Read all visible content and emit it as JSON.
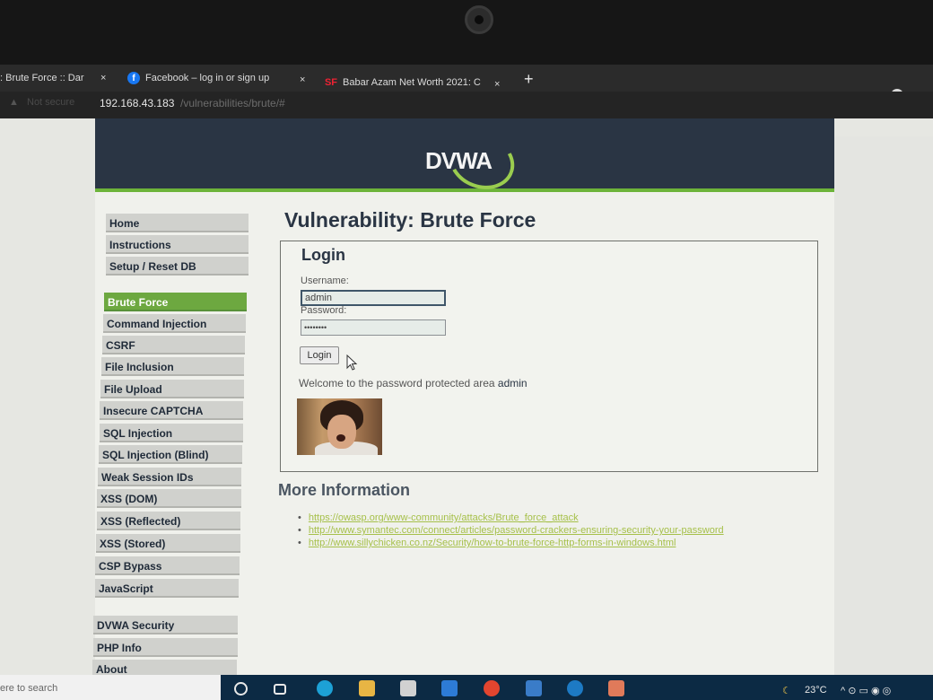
{
  "browser": {
    "tabs": [
      {
        "label": ": Brute Force :: Dar",
        "close": "×"
      },
      {
        "label": "Facebook – log in or sign up",
        "close": "×",
        "icon": "f"
      },
      {
        "label": "Babar Azam Net Worth 2021: C",
        "close": "×",
        "icon": "SF"
      }
    ],
    "new_tab": "+",
    "address": {
      "security": "Not secure",
      "host": "192.168.43.183",
      "path": "/vulnerabilities/brute/#"
    }
  },
  "site": {
    "logo": "DVWA",
    "menu_top": [
      "Home",
      "Instructions",
      "Setup / Reset DB"
    ],
    "menu_vulns": [
      "Brute Force",
      "Command Injection",
      "CSRF",
      "File Inclusion",
      "File Upload",
      "Insecure CAPTCHA",
      "SQL Injection",
      "SQL Injection (Blind)",
      "Weak Session IDs",
      "XSS (DOM)",
      "XSS (Reflected)",
      "XSS (Stored)",
      "CSP Bypass",
      "JavaScript"
    ],
    "menu_bottom": [
      "DVWA Security",
      "PHP Info",
      "About"
    ],
    "active_item": "Brute Force"
  },
  "page": {
    "title": "Vulnerability: Brute Force",
    "login": {
      "heading": "Login",
      "username_label": "Username:",
      "username_value": "admin",
      "password_label": "Password:",
      "password_value": "••••••••",
      "button": "Login",
      "welcome": "Welcome to the password protected area",
      "welcome_user": "admin"
    },
    "more_info": {
      "heading": "More Information",
      "links": [
        "https://owasp.org/www-community/attacks/Brute_force_attack",
        "http://www.symantec.com/connect/articles/password-crackers-ensuring-security-your-password",
        "http://www.sillychicken.co.nz/Security/how-to-brute-force-http-forms-in-windows.html"
      ]
    }
  },
  "taskbar": {
    "search": "ere to search",
    "temperature": "23°C"
  }
}
